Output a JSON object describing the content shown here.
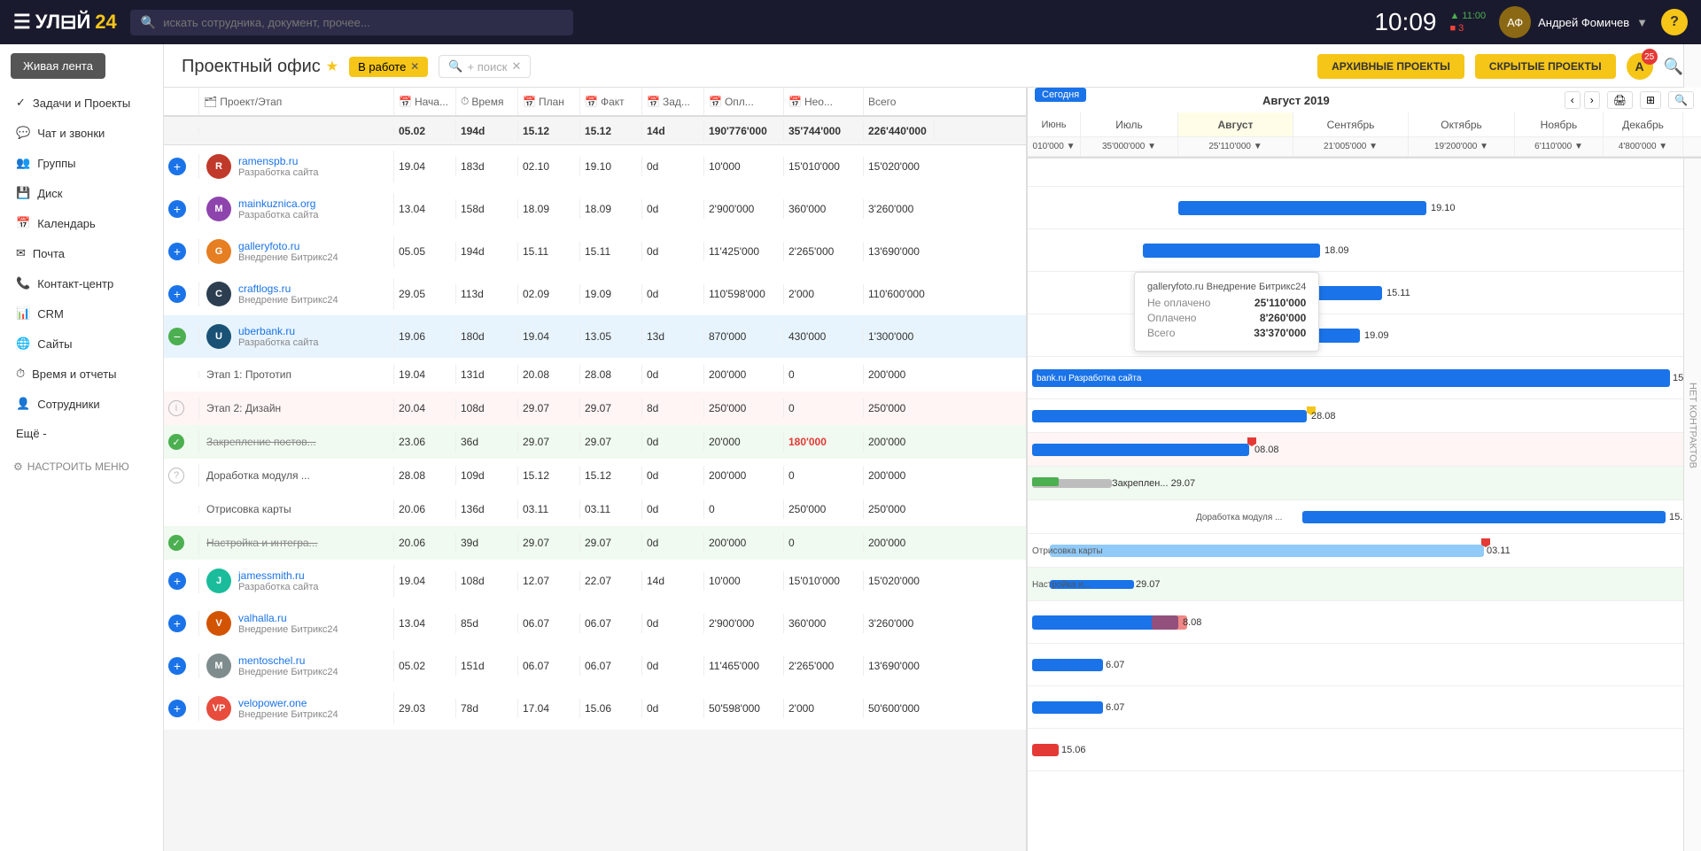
{
  "app": {
    "logo": "УЛ⊟Й",
    "version": "24",
    "time": "10:09",
    "notif1": "▲ 11:00",
    "notif2": "■ 3",
    "user_name": "Андрей Фомичев",
    "search_placeholder": "искать сотрудника, документ, прочее...",
    "help_label": "?"
  },
  "sidebar": {
    "live_feed": "Живая лента",
    "items": [
      {
        "label": "Задачи и Проекты"
      },
      {
        "label": "Чат и звонки"
      },
      {
        "label": "Группы"
      },
      {
        "label": "Диск"
      },
      {
        "label": "Календарь"
      },
      {
        "label": "Почта"
      },
      {
        "label": "Контакт-центр"
      },
      {
        "label": "CRM"
      },
      {
        "label": "Сайты"
      },
      {
        "label": "Время и отчеты"
      },
      {
        "label": "Сотрудники"
      },
      {
        "label": "Ещё -"
      }
    ],
    "configure": "НАСТРОИТЬ МЕНЮ"
  },
  "header": {
    "page_title": "Проектный офис",
    "filter_active": "В работе",
    "filter_placeholder": "+ поиск",
    "btn_archive": "АРХИВНЫЕ ПРОЕКТЫ",
    "btn_hidden": "СКРЫТЫЕ ПРОЕКТЫ"
  },
  "table_headers": {
    "project": "Проект/Этап",
    "start": "Нача...",
    "time": "Время",
    "plan": "План",
    "fact": "Факт",
    "tasks": "Зад...",
    "paid": "Опл...",
    "unpaid": "Нео...",
    "total": "Всего"
  },
  "gantt": {
    "period": "Август 2019",
    "today_label": "Сегодня",
    "months": [
      "Июнь",
      "Июль",
      "Август",
      "Сентябрь",
      "Октябрь",
      "Ноябрь",
      "Декабрь"
    ],
    "month_values": [
      "010'000 ▼",
      "35'000'000 ▼",
      "25'110'000 ▼",
      "21'005'000 ▼",
      "19'200'000 ▼",
      "6'110'000 ▼",
      "4'800'000 ▼"
    ],
    "vertical_label": "НЕТ КОНТРАКТОВ"
  },
  "summary": {
    "date": "05.02",
    "time": "194d",
    "plan": "15.12",
    "fact": "15.12",
    "tasks": "14d",
    "paid": "190'776'000",
    "unpaid": "35'744'000",
    "total": "226'440'000"
  },
  "projects": [
    {
      "id": "ramenspb",
      "name": "ramenspb.ru",
      "sub": "Разработка сайта",
      "avatar_color": "#c0392b",
      "avatar_text": "R",
      "start": "19.04",
      "time": "183d",
      "plan": "02.10",
      "fact": "19.10",
      "tasks": "0d",
      "paid": "10'000",
      "unpaid": "15'010'000",
      "total": "15'020'000"
    },
    {
      "id": "mainkuznica",
      "name": "mainkuznica.org",
      "sub": "Разработка сайта",
      "avatar_color": "#8e44ad",
      "avatar_text": "M",
      "start": "13.04",
      "time": "158d",
      "plan": "18.09",
      "fact": "18.09",
      "tasks": "0d",
      "paid": "2'900'000",
      "unpaid": "360'000",
      "total": "3'260'000"
    },
    {
      "id": "galleryfoto",
      "name": "galleryfoto.ru",
      "sub": "Внедрение Битрикс24",
      "avatar_color": "#e67e22",
      "avatar_text": "G",
      "start": "05.05",
      "time": "194d",
      "plan": "15.11",
      "fact": "15.11",
      "tasks": "0d",
      "paid": "11'425'000",
      "unpaid": "2'265'000",
      "total": "13'690'000"
    },
    {
      "id": "craftlogs",
      "name": "craftlogs.ru",
      "sub": "Внедрение Битрикс24",
      "avatar_color": "#2c3e50",
      "avatar_text": "C",
      "start": "29.05",
      "time": "113d",
      "plan": "02.09",
      "fact": "19.09",
      "tasks": "0d",
      "paid": "110'598'000",
      "unpaid": "2'000",
      "total": "110'600'000"
    },
    {
      "id": "uberbank",
      "name": "uberbank.ru",
      "sub": "Разработка сайта",
      "avatar_color": "#1a5276",
      "avatar_text": "U",
      "start": "19.06",
      "time": "180d",
      "plan": "19.04",
      "fact": "13.05",
      "tasks": "13d",
      "paid": "870'000",
      "unpaid": "430'000",
      "total": "1'300'000",
      "active": true,
      "stages": [
        {
          "name": "Этап 1: Прототип",
          "start": "19.04",
          "time": "131d",
          "plan": "20.08",
          "fact": "28.08",
          "tasks": "0d",
          "paid": "200'000",
          "unpaid": "0",
          "total": "200'000",
          "type": "normal"
        },
        {
          "name": "Этап 2: Дизайн",
          "start": "20.04",
          "time": "108d",
          "plan": "29.07",
          "fact": "29.07",
          "tasks": "8d",
          "paid": "250'000",
          "unpaid": "0",
          "total": "250'000",
          "type": "info"
        },
        {
          "name": "Закрепление постов...",
          "start": "23.06",
          "time": "36d",
          "plan": "29.07",
          "fact": "29.07",
          "tasks": "0d",
          "paid": "20'000",
          "unpaid": "180'000",
          "total": "200'000",
          "type": "check",
          "unpaid_red": true,
          "strikethrough": true
        },
        {
          "name": "Доработка модуля ...",
          "start": "28.08",
          "time": "109d",
          "plan": "15.12",
          "fact": "15.12",
          "tasks": "0d",
          "paid": "200'000",
          "unpaid": "0",
          "total": "200'000",
          "type": "question"
        },
        {
          "name": "Отрисовка карты",
          "start": "20.06",
          "time": "136d",
          "plan": "03.11",
          "fact": "03.11",
          "tasks": "0d",
          "paid": "0",
          "unpaid": "250'000",
          "total": "250'000",
          "type": "normal"
        },
        {
          "name": "Настройка и интегра...",
          "start": "20.06",
          "time": "39d",
          "plan": "29.07",
          "fact": "29.07",
          "tasks": "0d",
          "paid": "200'000",
          "unpaid": "0",
          "total": "200'000",
          "type": "check",
          "strikethrough": true
        }
      ]
    },
    {
      "id": "jamessmith",
      "name": "jamessmith.ru",
      "sub": "Разработка сайта",
      "avatar_color": "#1abc9c",
      "avatar_text": "J",
      "start": "19.04",
      "time": "108d",
      "plan": "12.07",
      "fact": "22.07",
      "tasks": "14d",
      "paid": "10'000",
      "unpaid": "15'010'000",
      "total": "15'020'000"
    },
    {
      "id": "valhalla",
      "name": "valhalla.ru",
      "sub": "Внедрение Битрикс24",
      "avatar_color": "#d35400",
      "avatar_text": "V",
      "start": "13.04",
      "time": "85d",
      "plan": "06.07",
      "fact": "06.07",
      "tasks": "0d",
      "paid": "2'900'000",
      "unpaid": "360'000",
      "total": "3'260'000"
    },
    {
      "id": "mentoschel",
      "name": "mentoschel.ru",
      "sub": "Внедрение Битрикс24",
      "avatar_color": "#7f8c8d",
      "avatar_text": "M",
      "start": "05.02",
      "time": "151d",
      "plan": "06.07",
      "fact": "06.07",
      "tasks": "0d",
      "paid": "11'465'000",
      "unpaid": "2'265'000",
      "total": "13'690'000"
    },
    {
      "id": "velopower",
      "name": "velopower.one",
      "sub": "Внедрение Битрикс24",
      "avatar_color": "#e74c3c",
      "avatar_text": "VP",
      "start": "29.03",
      "time": "78d",
      "plan": "17.04",
      "fact": "15.06",
      "tasks": "0d",
      "paid": "50'598'000",
      "unpaid": "2'000",
      "total": "50'600'000"
    }
  ],
  "tooltip": {
    "title": "galleryfoto.ru Внедрение Битрикс24",
    "unpaid_label": "Не оплачено",
    "unpaid_value": "25'110'000",
    "paid_label": "Оплачено",
    "paid_value": "8'260'000",
    "total_label": "Всего",
    "total_value": "33'370'000"
  }
}
